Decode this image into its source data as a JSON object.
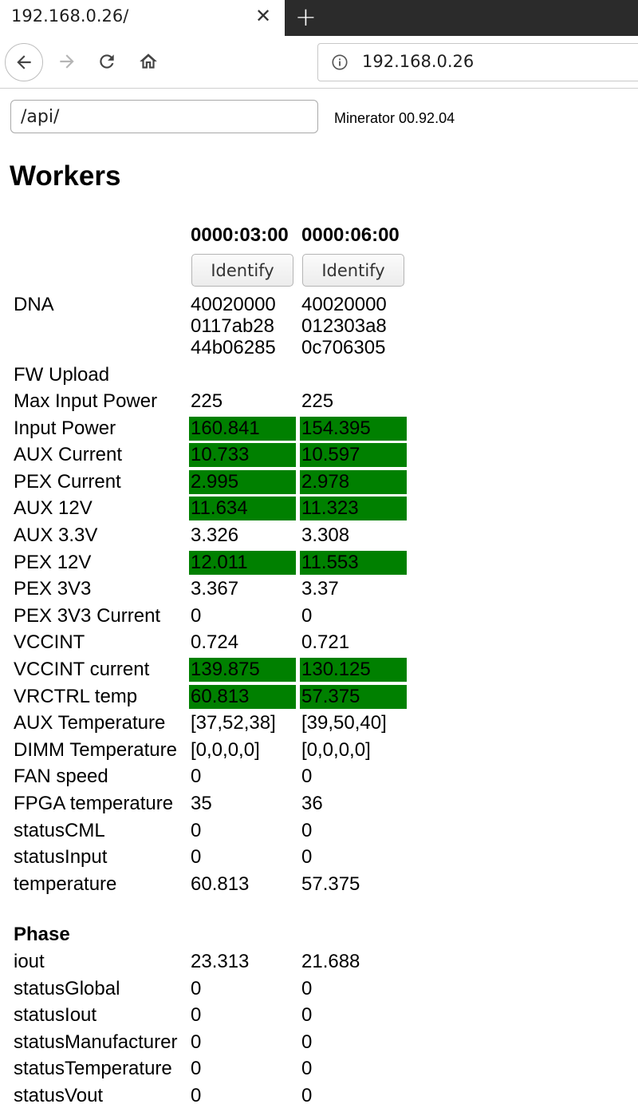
{
  "browser": {
    "tab_title": "192.168.0.26/",
    "close_glyph": "✕",
    "newtab_glyph": "+",
    "url": "192.168.0.26"
  },
  "page": {
    "api_input_value": "/api/",
    "version": "Minerator 00.92.04",
    "heading": "Workers"
  },
  "workers": {
    "columns": [
      "0000:03:00",
      "0000:06:00"
    ],
    "identify_label": "Identify",
    "dna": {
      "label": "DNA",
      "values": [
        [
          "40020000",
          "0117ab28",
          "44b06285"
        ],
        [
          "40020000",
          "012303a8",
          "0c706305"
        ]
      ]
    },
    "fw_upload_label": "FW Upload",
    "highlight_color": "#008000",
    "rows": [
      {
        "label": "Max Input Power",
        "values": [
          "225",
          "225"
        ],
        "highlight": false
      },
      {
        "label": "Input Power",
        "values": [
          "160.841",
          "154.395"
        ],
        "highlight": true
      },
      {
        "label": "AUX Current",
        "values": [
          "10.733",
          "10.597"
        ],
        "highlight": true
      },
      {
        "label": "PEX Current",
        "values": [
          "2.995",
          "2.978"
        ],
        "highlight": true
      },
      {
        "label": "AUX 12V",
        "values": [
          "11.634",
          "11.323"
        ],
        "highlight": true
      },
      {
        "label": "AUX 3.3V",
        "values": [
          "3.326",
          "3.308"
        ],
        "highlight": false
      },
      {
        "label": "PEX 12V",
        "values": [
          "12.011",
          "11.553"
        ],
        "highlight": true
      },
      {
        "label": "PEX 3V3",
        "values": [
          "3.367",
          "3.37"
        ],
        "highlight": false
      },
      {
        "label": "PEX 3V3 Current",
        "values": [
          "0",
          "0"
        ],
        "highlight": false
      },
      {
        "label": "VCCINT",
        "values": [
          "0.724",
          "0.721"
        ],
        "highlight": false
      },
      {
        "label": "VCCINT current",
        "values": [
          "139.875",
          "130.125"
        ],
        "highlight": true
      },
      {
        "label": "VRCTRL temp",
        "values": [
          "60.813",
          "57.375"
        ],
        "highlight": true
      },
      {
        "label": "AUX Temperature",
        "values": [
          "[37,52,38]",
          "[39,50,40]"
        ],
        "highlight": false
      },
      {
        "label": "DIMM Temperature",
        "values": [
          "[0,0,0,0]",
          "[0,0,0,0]"
        ],
        "highlight": false
      },
      {
        "label": "FAN speed",
        "values": [
          "0",
          "0"
        ],
        "highlight": false
      },
      {
        "label": "FPGA temperature",
        "values": [
          "35",
          "36"
        ],
        "highlight": false
      },
      {
        "label": "statusCML",
        "values": [
          "0",
          "0"
        ],
        "highlight": false
      },
      {
        "label": "statusInput",
        "values": [
          "0",
          "0"
        ],
        "highlight": false
      },
      {
        "label": "temperature",
        "values": [
          "60.813",
          "57.375"
        ],
        "highlight": false
      }
    ],
    "phase": {
      "title": "Phase",
      "rows": [
        {
          "label": "iout",
          "values": [
            "23.313",
            "21.688"
          ]
        },
        {
          "label": "statusGlobal",
          "values": [
            "0",
            "0"
          ]
        },
        {
          "label": "statusIout",
          "values": [
            "0",
            "0"
          ]
        },
        {
          "label": "statusManufacturer",
          "values": [
            "0",
            "0"
          ]
        },
        {
          "label": "statusTemperature",
          "values": [
            "0",
            "0"
          ]
        },
        {
          "label": "statusVout",
          "values": [
            "0",
            "0"
          ]
        }
      ]
    }
  }
}
